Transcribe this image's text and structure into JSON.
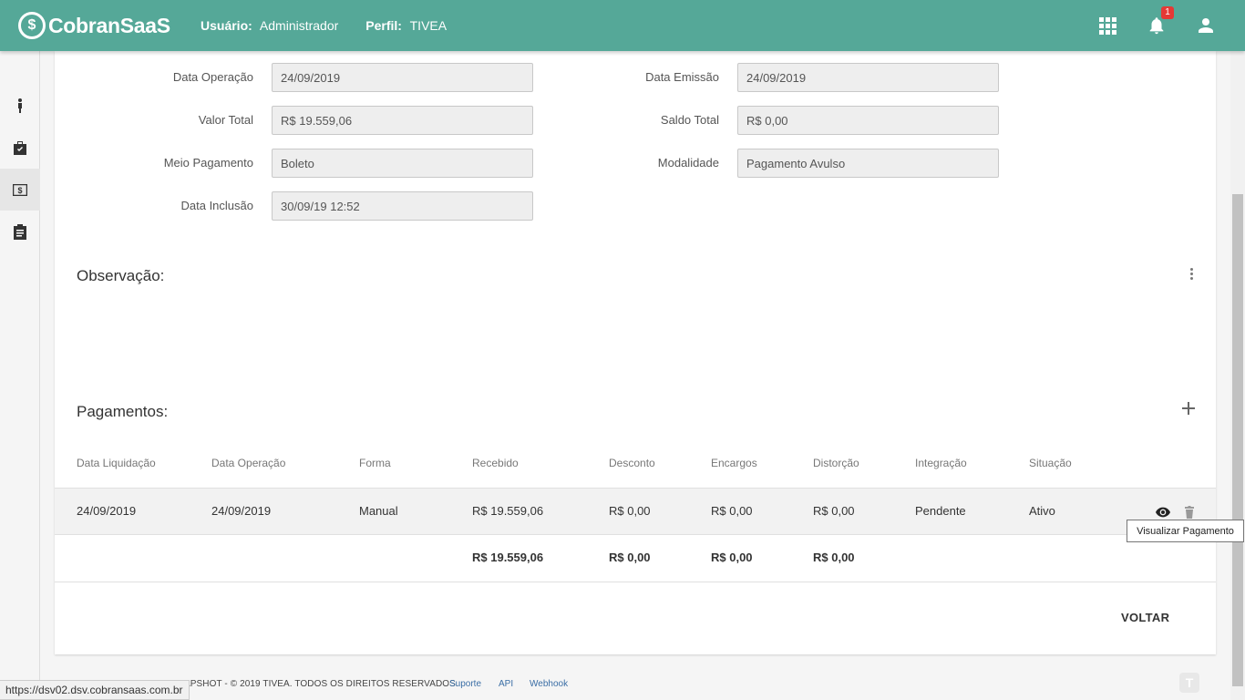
{
  "header": {
    "brand": "CobranSaaS",
    "brand_symbol": "$",
    "user_label": "Usuário:",
    "user_value": "Administrador",
    "profile_label": "Perfil:",
    "profile_value": "TIVEA",
    "notification_count": "1",
    "bg_color": "#55a898"
  },
  "sidebar": {
    "items": [
      {
        "icon": "person-icon"
      },
      {
        "icon": "briefcase-icon"
      },
      {
        "icon": "money-icon",
        "active": true
      },
      {
        "icon": "clipboard-icon"
      }
    ]
  },
  "form": {
    "data_operacao": {
      "label": "Data Operação",
      "value": "24/09/2019"
    },
    "data_emissao": {
      "label": "Data Emissão",
      "value": "24/09/2019"
    },
    "valor_total": {
      "label": "Valor Total",
      "value": "R$ 19.559,06"
    },
    "saldo_total": {
      "label": "Saldo Total",
      "value": "R$ 0,00"
    },
    "meio_pagamento": {
      "label": "Meio Pagamento",
      "value": "Boleto"
    },
    "modalidade": {
      "label": "Modalidade",
      "value": "Pagamento Avulso"
    },
    "data_inclusao": {
      "label": "Data Inclusão",
      "value": "30/09/19 12:52"
    }
  },
  "observacao": {
    "title": "Observação:"
  },
  "pagamentos": {
    "title": "Pagamentos:",
    "columns": [
      "Data Liquidação",
      "Data Operação",
      "Forma",
      "Recebido",
      "Desconto",
      "Encargos",
      "Distorção",
      "Integração",
      "Situação"
    ],
    "rows": [
      [
        "24/09/2019",
        "24/09/2019",
        "Manual",
        "R$ 19.559,06",
        "R$ 0,00",
        "R$ 0,00",
        "R$ 0,00",
        "Pendente",
        "Ativo"
      ]
    ],
    "totals": {
      "recebido": "R$ 19.559,06",
      "desconto": "R$ 0,00",
      "encargos": "R$ 0,00",
      "distorcao": "R$ 0,00"
    },
    "tooltip": "Visualizar Pagamento"
  },
  "actions": {
    "voltar": "VOLTAR"
  },
  "footer": {
    "copyright": "APSHOT - © 2019 TIVEA. TODOS OS DIREITOS RESERVADOS.",
    "links": [
      "Suporte",
      "API",
      "Webhook"
    ],
    "corner_logo": "T"
  },
  "status_bar": {
    "url": "https://dsv02.dsv.cobransaas.com.br"
  }
}
